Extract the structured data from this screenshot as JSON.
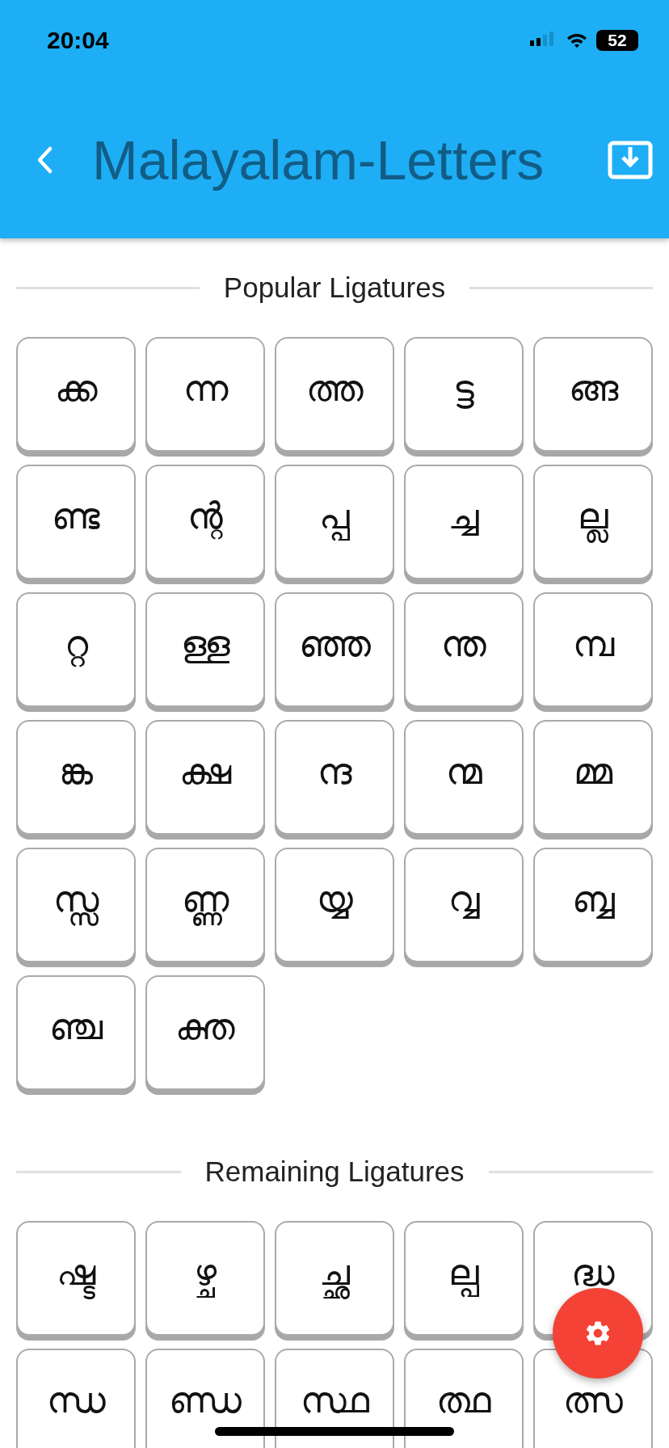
{
  "status_bar": {
    "time": "20:04",
    "battery": "52"
  },
  "app_bar": {
    "title": "Malayalam-Letters"
  },
  "sections": [
    {
      "title": "Popular Ligatures",
      "items": [
        "ക്ക",
        "ന്ന",
        "ത്ത",
        "ട്ട",
        "ങ്ങ",
        "ണ്ട",
        "ന്റ",
        "പ്പ",
        "ച്ച",
        "ല്ല",
        "റ്റ",
        "ള്ള",
        "ഞ്ഞ",
        "ന്ത",
        "മ്പ",
        "ങ്ക",
        "ക്ഷ",
        "ന്ദ",
        "ന്മ",
        "മ്മ",
        "സ്സ",
        "ണ്ണ",
        "യ്യ",
        "വ്വ",
        "ബ്ബ",
        "ഞ്ച",
        "ക്ത"
      ]
    },
    {
      "title": "Remaining Ligatures",
      "items": [
        "ഷ്ട",
        "ഴ്ച",
        "ച്ഛ",
        "ല്പ",
        "ദ്ധ",
        "ന്ധ",
        "ണ്ഡ",
        "സ്ഥ",
        "ത്ഥ",
        "ത്സ"
      ]
    }
  ]
}
